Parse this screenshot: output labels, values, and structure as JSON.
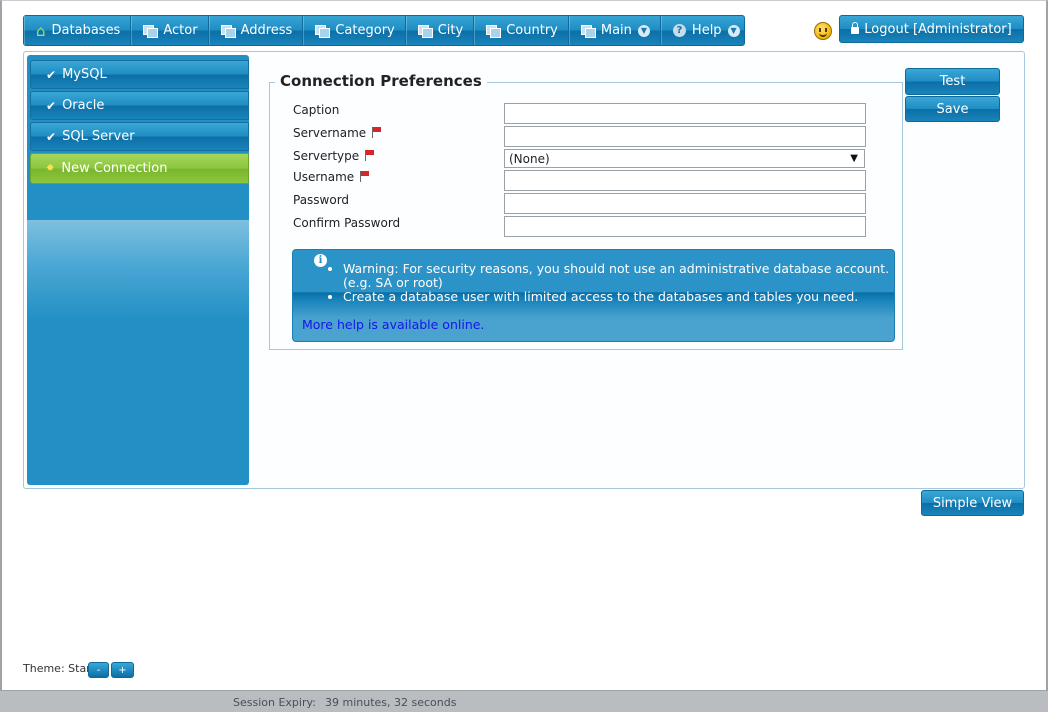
{
  "menu": {
    "items": [
      {
        "label": "Databases",
        "icon": "home-icon"
      },
      {
        "label": "Actor",
        "icon": "window-icon"
      },
      {
        "label": "Address",
        "icon": "window-icon"
      },
      {
        "label": "Category",
        "icon": "window-icon"
      },
      {
        "label": "City",
        "icon": "window-icon"
      },
      {
        "label": "Country",
        "icon": "window-icon"
      },
      {
        "label": "Main",
        "icon": "window-icon"
      },
      {
        "label": "Help",
        "icon": "help-icon"
      }
    ]
  },
  "header": {
    "logout_label": "Logout [Administrator]"
  },
  "sidebar": {
    "items": [
      {
        "label": "MySQL"
      },
      {
        "label": "Oracle"
      },
      {
        "label": "SQL Server"
      },
      {
        "label": "New Connection",
        "active": true
      }
    ]
  },
  "form": {
    "title": "Connection Preferences",
    "fields": [
      {
        "label": "Caption",
        "value": "",
        "required": false
      },
      {
        "label": "Servername",
        "value": "",
        "required": true
      },
      {
        "label": "Servertype",
        "value": "(None)",
        "required": true
      },
      {
        "label": "Username",
        "value": "",
        "required": true
      },
      {
        "label": "Password",
        "value": "",
        "required": false
      },
      {
        "label": "Confirm Password",
        "value": "",
        "required": false
      }
    ]
  },
  "info": {
    "bullets": [
      "Warning: For security reasons, you should not use an administrative database account. (e.g. SA or root)",
      "Create a database user with limited access to the databases and tables you need."
    ],
    "link_text": "More help is available online."
  },
  "buttons": {
    "test": "Test",
    "save": "Save",
    "simple_view": "Simple View"
  },
  "theme": {
    "label": "Theme: Start",
    "minus": "-",
    "plus": "+"
  },
  "status": {
    "label": "Session Expiry:",
    "value": "39 minutes, 32 seconds"
  },
  "colors": {
    "accent": "#1f8cc3",
    "active": "#8cc63e",
    "link": "#1616e8"
  }
}
